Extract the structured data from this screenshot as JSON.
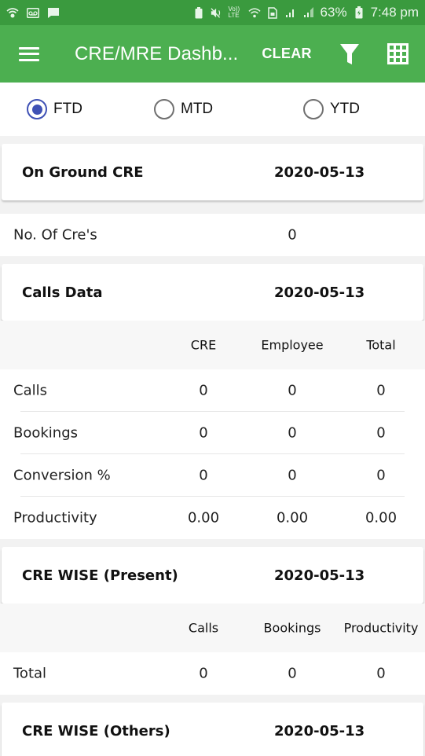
{
  "status_bar": {
    "left_icons": [
      "wifi-shield-icon",
      "voicemail-icon",
      "message-icon"
    ],
    "right_icons": [
      "battery-saver-icon",
      "mute-icon",
      "volte-icon",
      "wifi-icon",
      "sim-icon",
      "signal-1-icon",
      "signal-2-icon"
    ],
    "volte_label": "Vo)) LTE",
    "battery": "63%",
    "time": "7:48 pm"
  },
  "app_bar": {
    "title": "CRE/MRE Dashb...",
    "clear_label": "CLEAR",
    "background": "#4caf50"
  },
  "period_selector": {
    "options": [
      {
        "label": "FTD",
        "selected": true
      },
      {
        "label": "MTD",
        "selected": false
      },
      {
        "label": "YTD",
        "selected": false
      }
    ],
    "accent": "#3f51b5"
  },
  "sections": {
    "on_ground": {
      "title": "On Ground CRE",
      "date": "2020-05-13",
      "rows": [
        {
          "label": "No. Of Cre's",
          "value": "0"
        }
      ]
    },
    "calls_data": {
      "title": "Calls Data",
      "date": "2020-05-13",
      "columns": [
        "CRE",
        "Employee",
        "Total"
      ],
      "rows": [
        {
          "label": "Calls",
          "values": [
            "0",
            "0",
            "0"
          ]
        },
        {
          "label": "Bookings",
          "values": [
            "0",
            "0",
            "0"
          ]
        },
        {
          "label": "Conversion %",
          "values": [
            "0",
            "0",
            "0"
          ]
        },
        {
          "label": "Productivity",
          "values": [
            "0.00",
            "0.00",
            "0.00"
          ]
        }
      ]
    },
    "cre_wise_present": {
      "title": "CRE WISE (Present)",
      "date": "2020-05-13",
      "columns": [
        "Calls",
        "Bookings",
        "Productivity"
      ],
      "rows": [
        {
          "label": "Total",
          "values": [
            "0",
            "0",
            "0"
          ]
        }
      ]
    },
    "cre_wise_others": {
      "title": "CRE WISE (Others)",
      "date": "2020-05-13"
    }
  }
}
